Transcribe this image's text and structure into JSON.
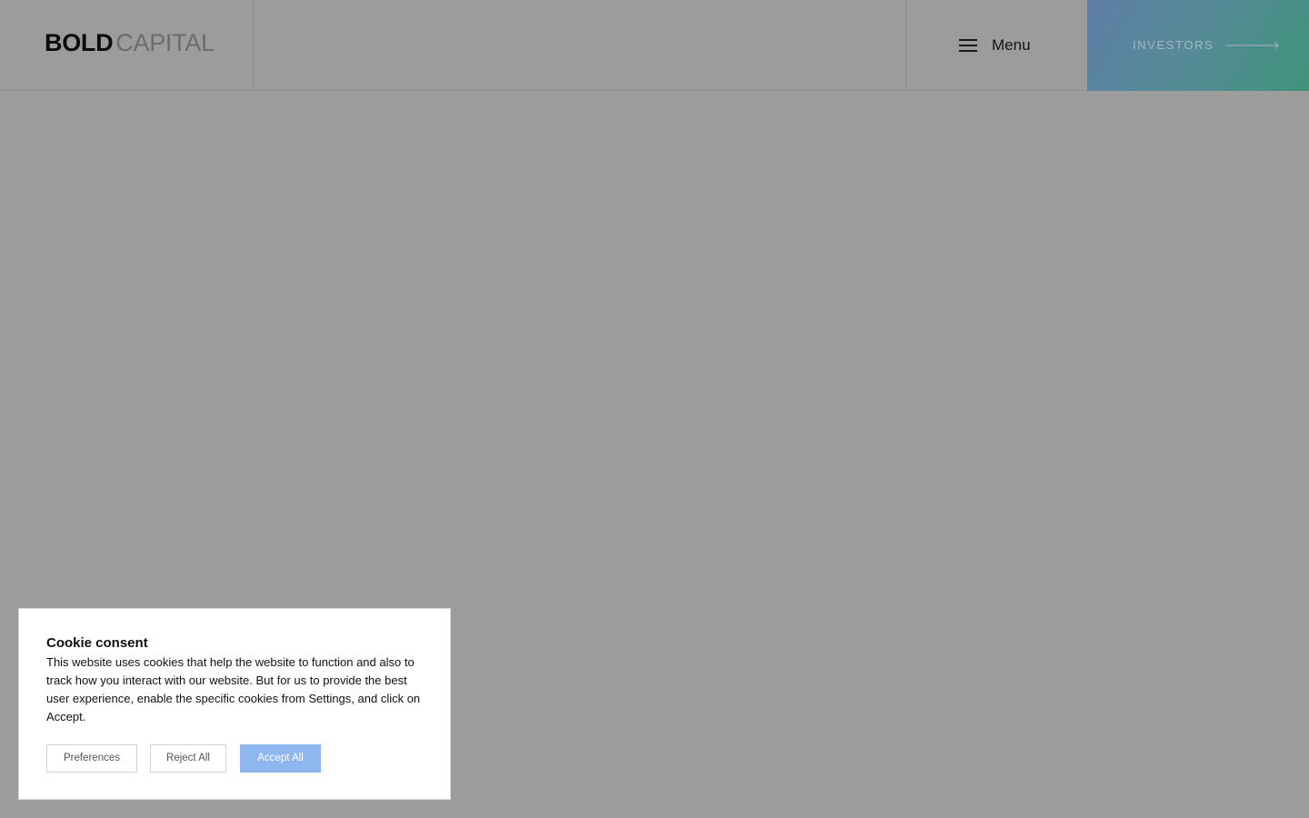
{
  "header": {
    "logo_bold": "BOLD",
    "logo_light": "CAPITAL",
    "menu_label": "Menu",
    "investors_label": "INVESTORS"
  },
  "cookie": {
    "title": "Cookie consent",
    "text": "This website uses cookies that help the website to function and also to track how you interact with our website. But for us to provide the best user experience, enable the specific cookies from Settings, and click on Accept.",
    "preferences_label": "Preferences",
    "reject_label": "Reject All",
    "accept_label": "Accept All"
  },
  "icons": {
    "menu": "hamburger-icon",
    "investors_arrow": "arrow-right-icon"
  },
  "colors": {
    "overlay": "#9d9c9d",
    "accept_button": "#8fb7ef",
    "investors_gradient_start": "#5e7ea6",
    "investors_gradient_end": "#3f937a"
  }
}
